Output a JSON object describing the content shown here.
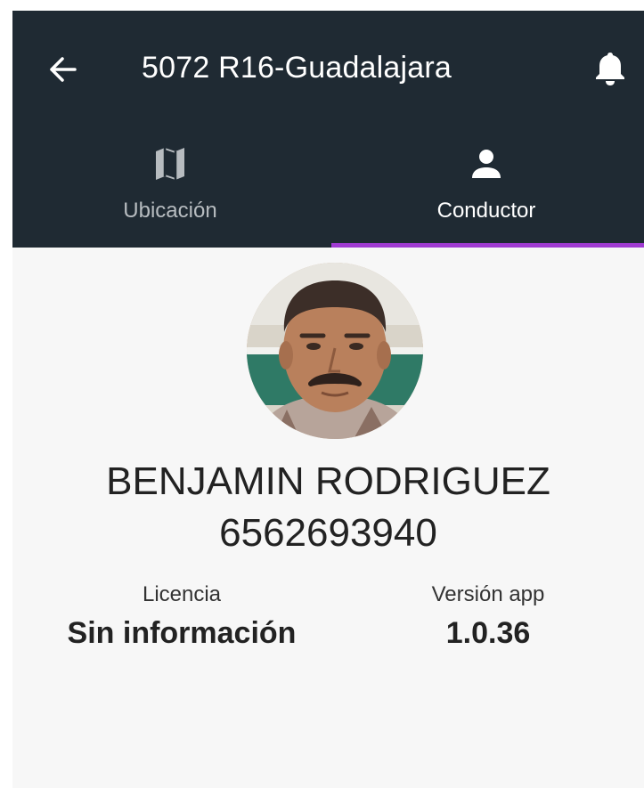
{
  "header": {
    "title": "5072 R16-Guadalajara",
    "back_icon": "back-arrow-icon",
    "bell_icon": "bell-icon"
  },
  "tabs": [
    {
      "label": "Ubicación",
      "icon": "map-icon",
      "selected": false
    },
    {
      "label": "Conductor",
      "icon": "person-icon",
      "selected": true
    }
  ],
  "driver": {
    "name": "BENJAMIN RODRIGUEZ",
    "phone": "6562693940"
  },
  "info": {
    "license_label": "Licencia",
    "license_value": "Sin información",
    "app_version_label": "Versión app",
    "app_version_value": "1.0.36"
  },
  "colors": {
    "appbar": "#1f2a33",
    "tab_indicator": "#a03bd2",
    "tab_inactive_text": "#b7bcc0",
    "background": "#f7f7f7"
  }
}
